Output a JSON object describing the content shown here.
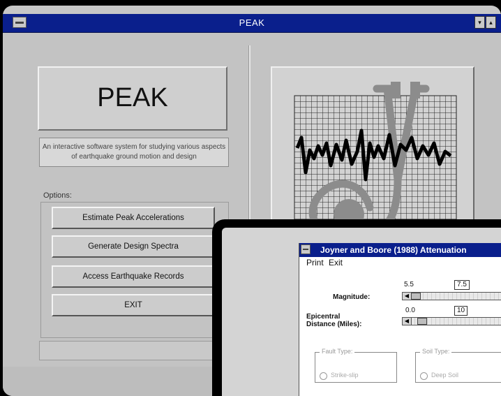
{
  "main_window": {
    "title": "PEAK",
    "min_glyph": "▾",
    "max_glyph": "▴"
  },
  "logo_text": "PEAK",
  "description": "An interactive software system for studying various aspects of earthquake ground motion and design",
  "options": {
    "label": "Options:",
    "buttons": [
      "Estimate Peak Accelerations",
      "Generate Design Spectra",
      "Access Earthquake Records",
      "EXIT"
    ]
  },
  "dialog": {
    "title": "Joyner and Boore (1988)  Attenuation",
    "menu": [
      "Print",
      "Exit"
    ],
    "magnitude": {
      "label": "Magnitude:",
      "min": "5.5",
      "current": "7.5",
      "slider_fraction": 0.0
    },
    "distance": {
      "label_line1": "Epicentral",
      "label_line2": "Distance (Miles):",
      "min": "0.0",
      "current": "10",
      "slider_fraction": 0.08
    },
    "fault_type": {
      "legend": "Fault Type:",
      "option": "Strike-slip"
    },
    "soil_type": {
      "legend": "Soil Type:",
      "option": "Deep Soil"
    }
  },
  "colors": {
    "titlebar": "#0a1f8c",
    "window_bg": "#c3c3c3",
    "illustration_trace": "#000000",
    "illustration_stethoscope": "#8c8c8c"
  }
}
